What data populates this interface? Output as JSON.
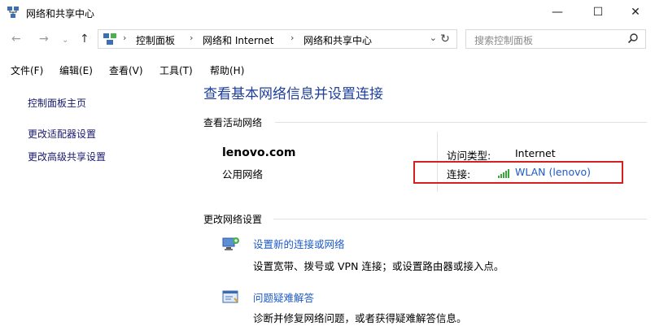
{
  "window": {
    "title": "网络和共享中心",
    "minimize": "—",
    "maximize": "☐",
    "close": "✕"
  },
  "nav": {
    "back": "←",
    "forward": "→",
    "up": "↑",
    "crumbs": [
      "控制面板",
      "网络和 Internet",
      "网络和共享中心"
    ],
    "separator": "›",
    "dropdown": "⌄",
    "refresh": "↻",
    "search_placeholder": "搜索控制面板",
    "search_glyph": "⚲"
  },
  "menu": [
    "文件(F)",
    "编辑(E)",
    "查看(V)",
    "工具(T)",
    "帮助(H)"
  ],
  "sidebar": {
    "items": [
      "控制面板主页",
      "更改适配器设置",
      "更改高级共享设置"
    ]
  },
  "main": {
    "heading": "查看基本网络信息并设置连接",
    "active_section": "查看活动网络",
    "network": {
      "name": "lenovo.com",
      "type": "公用网络",
      "access_label": "访问类型:",
      "access_value": "Internet",
      "connection_label": "连接:",
      "connection_value": "WLAN (lenovo)"
    },
    "change_section": "更改网络设置",
    "tasks": [
      {
        "title": "设置新的连接或网络",
        "desc": "设置宽带、拨号或 VPN 连接；或设置路由器或接入点。"
      },
      {
        "title": "问题疑难解答",
        "desc": "诊断并修复网络问题，或者获得疑难解答信息。"
      }
    ]
  },
  "colors": {
    "heading": "#1e3f9a",
    "link": "#1e5bc6",
    "highlight_box": "#d42020",
    "signal": "#3aa53a"
  }
}
